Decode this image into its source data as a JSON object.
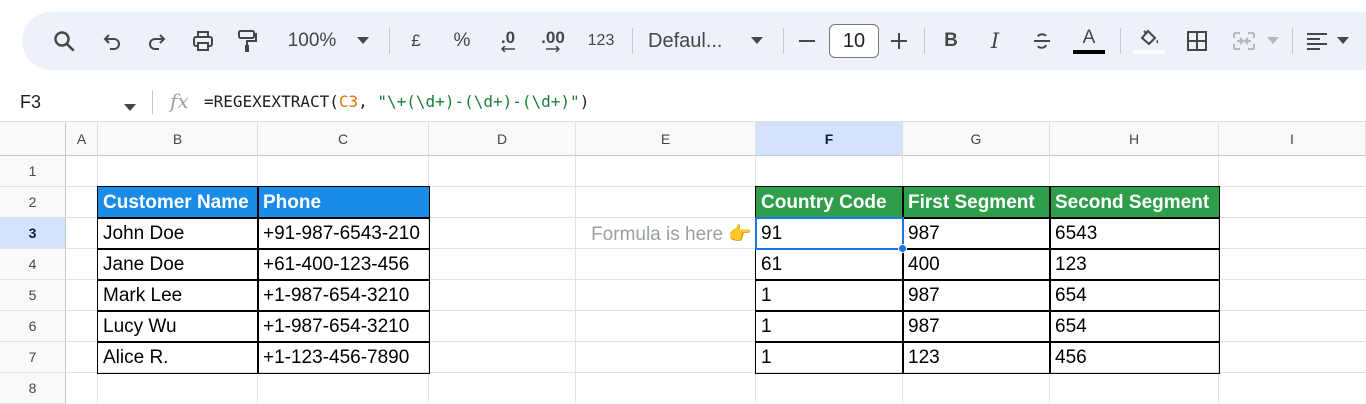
{
  "toolbar": {
    "zoom": "100%",
    "currency": "£",
    "percent": "%",
    "decrease_decimal": ".0",
    "increase_decimal": ".00",
    "number_format": "123",
    "font_name": "Defaul...",
    "font_size": "10",
    "bold": "B",
    "italic": "I",
    "text_color": "A"
  },
  "formula_bar": {
    "cell_ref": "F3",
    "formula_prefix": "=REGEXEXTRACT(",
    "formula_ref": "C3",
    "formula_mid": ", ",
    "formula_string": "\"\\+(\\d+)-(\\d+)-(\\d+)\"",
    "formula_suffix": ")"
  },
  "columns": [
    "A",
    "B",
    "C",
    "D",
    "E",
    "F",
    "G",
    "H",
    "I"
  ],
  "selected_column": "F",
  "rows": [
    "1",
    "2",
    "3",
    "4",
    "5",
    "6",
    "7",
    "8"
  ],
  "selected_row": "3",
  "left_table": {
    "headers": [
      "Customer Name",
      "Phone"
    ],
    "rows": [
      [
        "John Doe",
        "+91-987-6543-210"
      ],
      [
        "Jane Doe",
        "+61-400-123-456"
      ],
      [
        "Mark Lee",
        "+1-987-654-3210"
      ],
      [
        "Lucy Wu",
        "+1-987-654-3210"
      ],
      [
        "Alice R.",
        "+1-123-456-7890"
      ]
    ]
  },
  "note": "Formula is here 👉",
  "right_table": {
    "headers": [
      "Country Code",
      "First Segment",
      "Second Segment"
    ],
    "rows": [
      [
        "91",
        "987",
        "6543"
      ],
      [
        "61",
        "400",
        "123"
      ],
      [
        "1",
        "987",
        "654"
      ],
      [
        "1",
        "987",
        "654"
      ],
      [
        "1",
        "123",
        "456"
      ]
    ]
  },
  "colors": {
    "left_header_bg": "#1a8ce8",
    "right_header_bg": "#2e9e4a",
    "selection": "#1a73e8",
    "selected_header_bg": "#d3e3fd"
  }
}
